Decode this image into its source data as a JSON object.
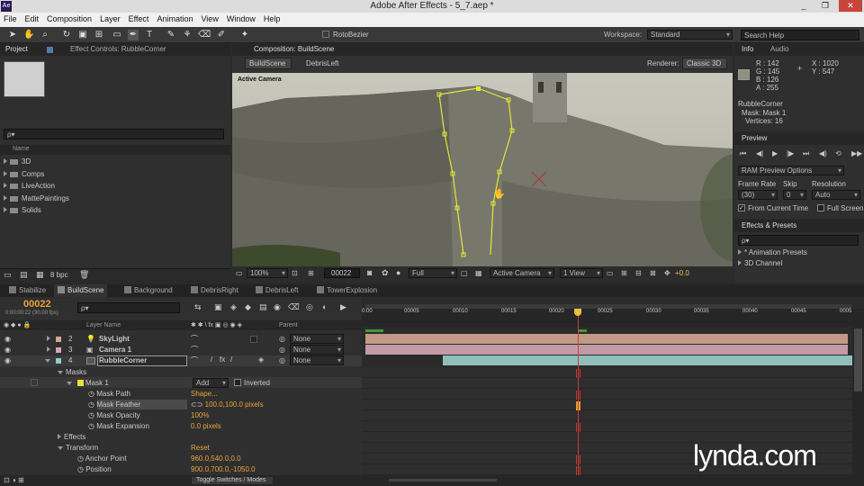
{
  "window": {
    "title": "Adobe After Effects - 5_7.aep *",
    "app_icon": "Ae",
    "minimize": "_",
    "maximize": "❐",
    "close": "✕"
  },
  "menu": [
    "File",
    "Edit",
    "Composition",
    "Layer",
    "Effect",
    "Animation",
    "View",
    "Window",
    "Help"
  ],
  "toolbar": {
    "rotobezier": "RotoBezier",
    "workspace_label": "Workspace:",
    "workspace_value": "Standard",
    "search_placeholder": "Search Help"
  },
  "project": {
    "tab": "Project",
    "effect_tab": "Effect Controls: RubbleCorner",
    "search_placeholder": "ρ▾",
    "name_col": "Name",
    "items": [
      "3D",
      "Comps",
      "LiveAction",
      "MattePaintings",
      "Solids"
    ],
    "bpc": "8 bpc"
  },
  "comp": {
    "tab": "Composition: BuildScene",
    "breadcrumb": [
      "BuildScene",
      "DebrisLeft"
    ],
    "renderer_label": "Renderer:",
    "renderer": "Classic 3D",
    "camera_label": "Active Camera",
    "zoom": "100%",
    "timecode": "00022",
    "resolution": "Full",
    "view": "Active Camera",
    "views": "1 View",
    "exposure": "+0.0"
  },
  "info": {
    "tab": "Info",
    "audio_tab": "Audio",
    "R": "R : 142",
    "G": "G : 145",
    "B": "B : 126",
    "A": "A : 255",
    "X": "X : 1020",
    "Y": "Y : 547",
    "layer": "RubbleCorner",
    "mask": "Mask: Mask 1",
    "vertices": "Vertices: 16",
    "swatch": "#8e917e"
  },
  "preview": {
    "tab": "Preview",
    "ram": "RAM Preview Options",
    "frame_rate_label": "Frame Rate",
    "skip_label": "Skip",
    "resolution_label": "Resolution",
    "frame_rate": "(30)",
    "skip": "0",
    "resolution": "Auto",
    "from_current": "From Current Time",
    "full_screen": "Full Screen"
  },
  "effects": {
    "tab": "Effects & Presets",
    "search": "ρ▾",
    "items": [
      "* Animation Presets",
      "3D Channel"
    ]
  },
  "timeline_tabs": [
    "Stabilize",
    "BuildScene",
    "Background",
    "DebrisRight",
    "DebrisLeft",
    "TowerExplosion"
  ],
  "timeline": {
    "timecode": "00022",
    "sub_timecode": "0:00:00:22 (30.00 fps)",
    "layer_name_col": "Layer Name",
    "parent_col": "Parent",
    "ruler": [
      "0:00",
      "00005",
      "00010",
      "00015",
      "00020",
      "00025",
      "00030",
      "00035",
      "00040",
      "00045",
      "0005"
    ],
    "layers": [
      {
        "num": "2",
        "name": "SkyLight",
        "parent": "None"
      },
      {
        "num": "3",
        "name": "Camera 1",
        "parent": "None"
      },
      {
        "num": "4",
        "name": "RubbleCorner",
        "parent": "None"
      }
    ],
    "props": [
      {
        "label": "Masks",
        "value": ""
      },
      {
        "label": "Mask 1",
        "value": "Add",
        "extra": "Inverted"
      },
      {
        "label": "Mask Path",
        "value": "Shape..."
      },
      {
        "label": "Mask Feather",
        "value": "100.0,100.0 pixels"
      },
      {
        "label": "Mask Opacity",
        "value": "100%"
      },
      {
        "label": "Mask Expansion",
        "value": "0.0 pixels"
      },
      {
        "label": "Effects",
        "value": ""
      },
      {
        "label": "Transform",
        "value": "Reset"
      },
      {
        "label": "Anchor Point",
        "value": "960.0,540.0,0.0"
      },
      {
        "label": "Position",
        "value": "900.0,700.0,-1050.0"
      }
    ],
    "toggle": "Toggle Switches / Modes"
  },
  "watermark": "lynda.com"
}
